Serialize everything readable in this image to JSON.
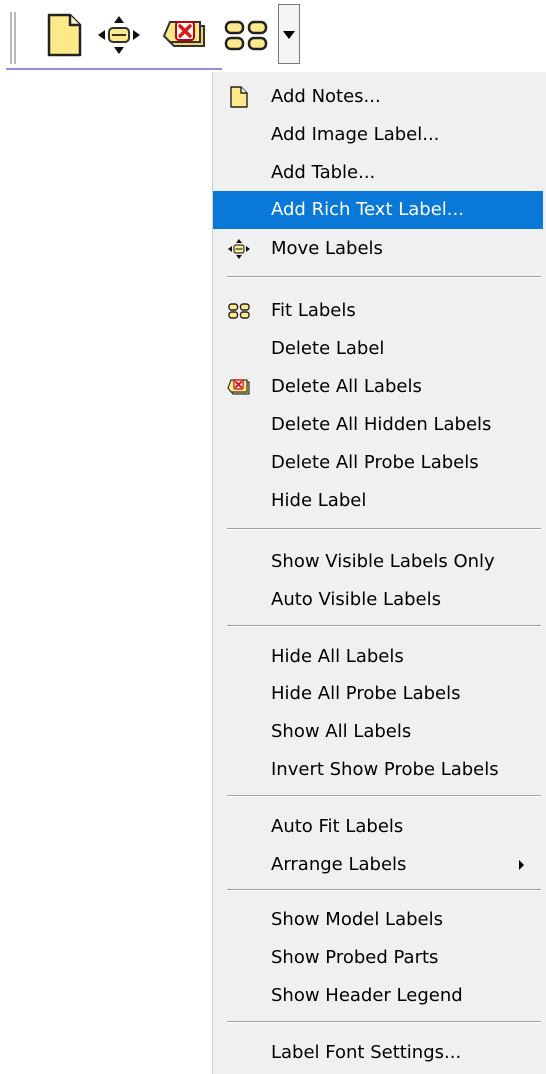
{
  "toolbar": {
    "buttons": [
      {
        "icon": "notes-icon"
      },
      {
        "icon": "move-labels-icon"
      },
      {
        "icon": "delete-all-labels-icon"
      },
      {
        "icon": "fit-labels-icon"
      },
      {
        "icon": "dropdown-arrow-icon"
      }
    ]
  },
  "menu": {
    "items": [
      {
        "label": "Add Notes...",
        "icon": "notes-icon"
      },
      {
        "label": "Add Image Label..."
      },
      {
        "label": "Add Table..."
      },
      {
        "label": "Add Rich Text Label...",
        "highlighted": true
      },
      {
        "label": "Move Labels",
        "icon": "move-labels-icon"
      },
      {
        "label": "Fit Labels",
        "icon": "fit-labels-icon"
      },
      {
        "label": "Delete Label"
      },
      {
        "label": "Delete All Labels",
        "icon": "delete-all-labels-icon"
      },
      {
        "label": "Delete All Hidden Labels"
      },
      {
        "label": "Delete All Probe Labels"
      },
      {
        "label": "Hide Label"
      },
      {
        "label": "Show Visible Labels Only"
      },
      {
        "label": "Auto Visible Labels"
      },
      {
        "label": "Hide All Labels"
      },
      {
        "label": "Hide All Probe Labels"
      },
      {
        "label": "Show All Labels"
      },
      {
        "label": "Invert Show Probe Labels"
      },
      {
        "label": "Auto Fit Labels"
      },
      {
        "label": "Arrange Labels",
        "submenu": true
      },
      {
        "label": "Show Model Labels"
      },
      {
        "label": "Show Probed Parts"
      },
      {
        "label": "Show Header Legend"
      },
      {
        "label": "Label Font Settings..."
      }
    ]
  },
  "colors": {
    "highlight": "#0a78d7",
    "menu_bg": "#f0f0f0",
    "icon_yellow": "#fbe98a",
    "icon_red": "#e01818"
  }
}
